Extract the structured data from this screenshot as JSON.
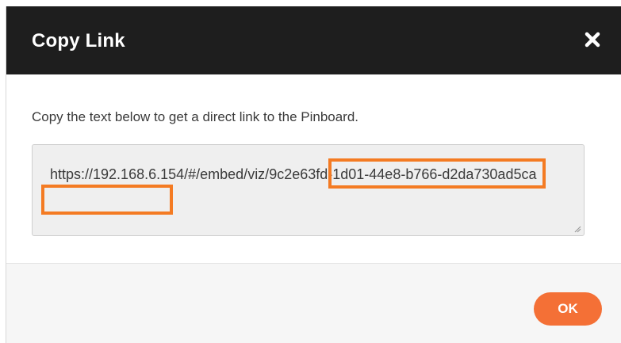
{
  "dialog": {
    "title": "Copy Link",
    "close_icon": "close-icon",
    "instruction": "Copy the text below to get a direct link to the Pinboard.",
    "link_value": "https://192.168.6.154/#/embed/viz/9c2e63fd-1d01-44e8-b766-d2da730ad5ca",
    "ok_label": "OK"
  },
  "colors": {
    "header_bg": "#1e1e1e",
    "highlight": "#f47b23",
    "ok_button": "#f47036"
  }
}
